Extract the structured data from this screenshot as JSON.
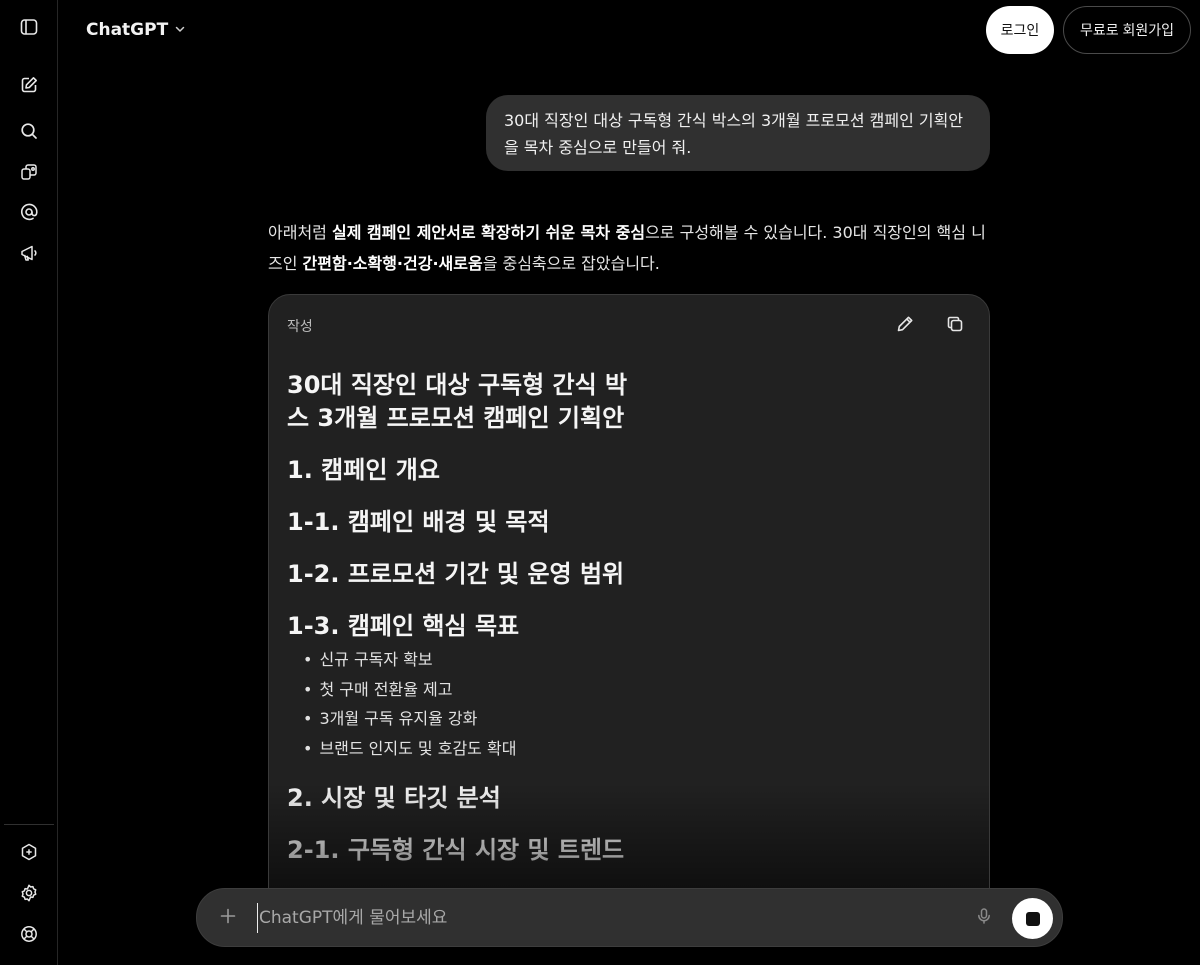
{
  "header": {
    "model_name": "ChatGPT",
    "login_label": "로그인",
    "signup_label": "무료로 회원가입"
  },
  "sidebar": {
    "top_items": [
      {
        "icon": "sidebar-toggle-icon"
      },
      {
        "icon": "new-chat-icon"
      },
      {
        "icon": "search-icon"
      },
      {
        "icon": "library-icon"
      },
      {
        "icon": "at-sign-icon"
      },
      {
        "icon": "megaphone-icon"
      }
    ],
    "bottom_items": [
      {
        "icon": "plus-hexagon-icon"
      },
      {
        "icon": "settings-gear-icon"
      },
      {
        "icon": "help-lifebuoy-icon"
      }
    ]
  },
  "conversation": {
    "user_message": "30대 직장인 대상 구독형 간식 박스의 3개월 프로모션 캠페인 기획안을 목차 중심으로 만들어 줘.",
    "assistant_intro": {
      "p1": "아래처럼 ",
      "b1": "실제 캠페인 제안서로 확장하기 쉬운 목차 중심",
      "p2": "으로 구성해볼 수 있습니다. 30대 직장인의 핵심 니즈인 ",
      "b2": "간편함·소확행·건강·새로움",
      "p3": "을 중심축으로 잡았습니다."
    }
  },
  "canvas": {
    "label": "작성",
    "title": "30대 직장인 대상 구독형 간식 박스 3개월 프로모션 캠페인 기획안",
    "sections": [
      {
        "heading": "1. 캠페인 개요"
      },
      {
        "heading": "1-1. 캠페인 배경 및 목적"
      },
      {
        "heading": "1-2. 프로모션 기간 및 운영 범위"
      },
      {
        "heading": "1-3. 캠페인 핵심 목표",
        "bullets": [
          "신규 구독자 확보",
          "첫 구매 전환율 제고",
          "3개월 구독 유지율 강화",
          "브랜드 인지도 및 호감도 확대"
        ]
      },
      {
        "heading": "2. 시장 및 타깃 분석"
      },
      {
        "heading": "2-1. 구독형 간식 시장 및 트렌드"
      }
    ]
  },
  "composer": {
    "placeholder": "ChatGPT에게 물어보세요"
  }
}
